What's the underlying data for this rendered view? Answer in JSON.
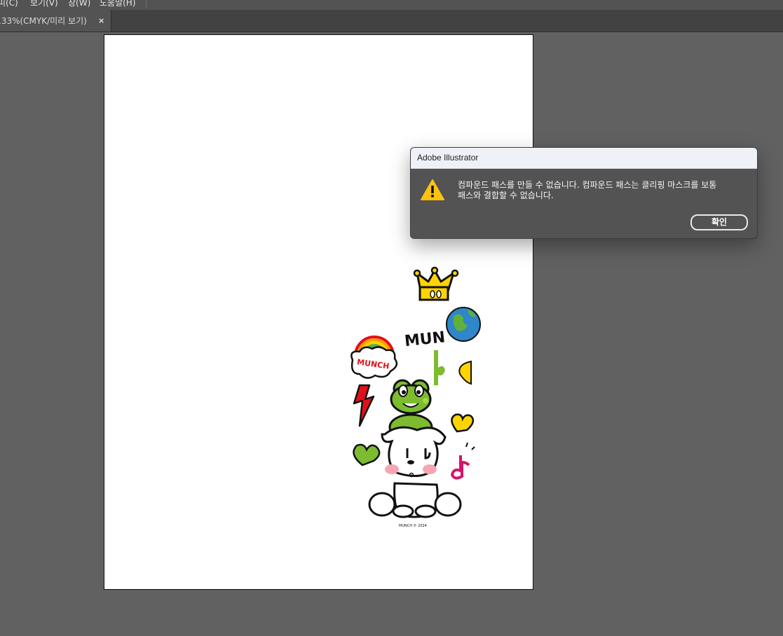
{
  "menubar": {
    "items": [
      "피(C)",
      "보기(V)",
      "창(W)",
      "도움말(H)"
    ]
  },
  "document_tab": {
    "label": ".33%(CMYK/미리 보기)",
    "close_glyph": "×"
  },
  "artwork": {
    "munch_text": "MUN",
    "cloud_text": "MUNCH",
    "copyright": "MUNCH © 2024",
    "colors": {
      "green": "#7cbc2e",
      "yellow": "#ffd400",
      "pink": "#d4146a",
      "red": "#e3101a",
      "blue": "#2f86c8"
    }
  },
  "dialog": {
    "title": "Adobe Illustrator",
    "icon": "warning-icon",
    "message_line1": "컴파운드 패스를 만들 수 없습니다. 컴파운드 패스는 클리핑 마스크를 보통",
    "message_line2": "패스와 결합할 수 없습니다.",
    "ok_label": "확인"
  }
}
